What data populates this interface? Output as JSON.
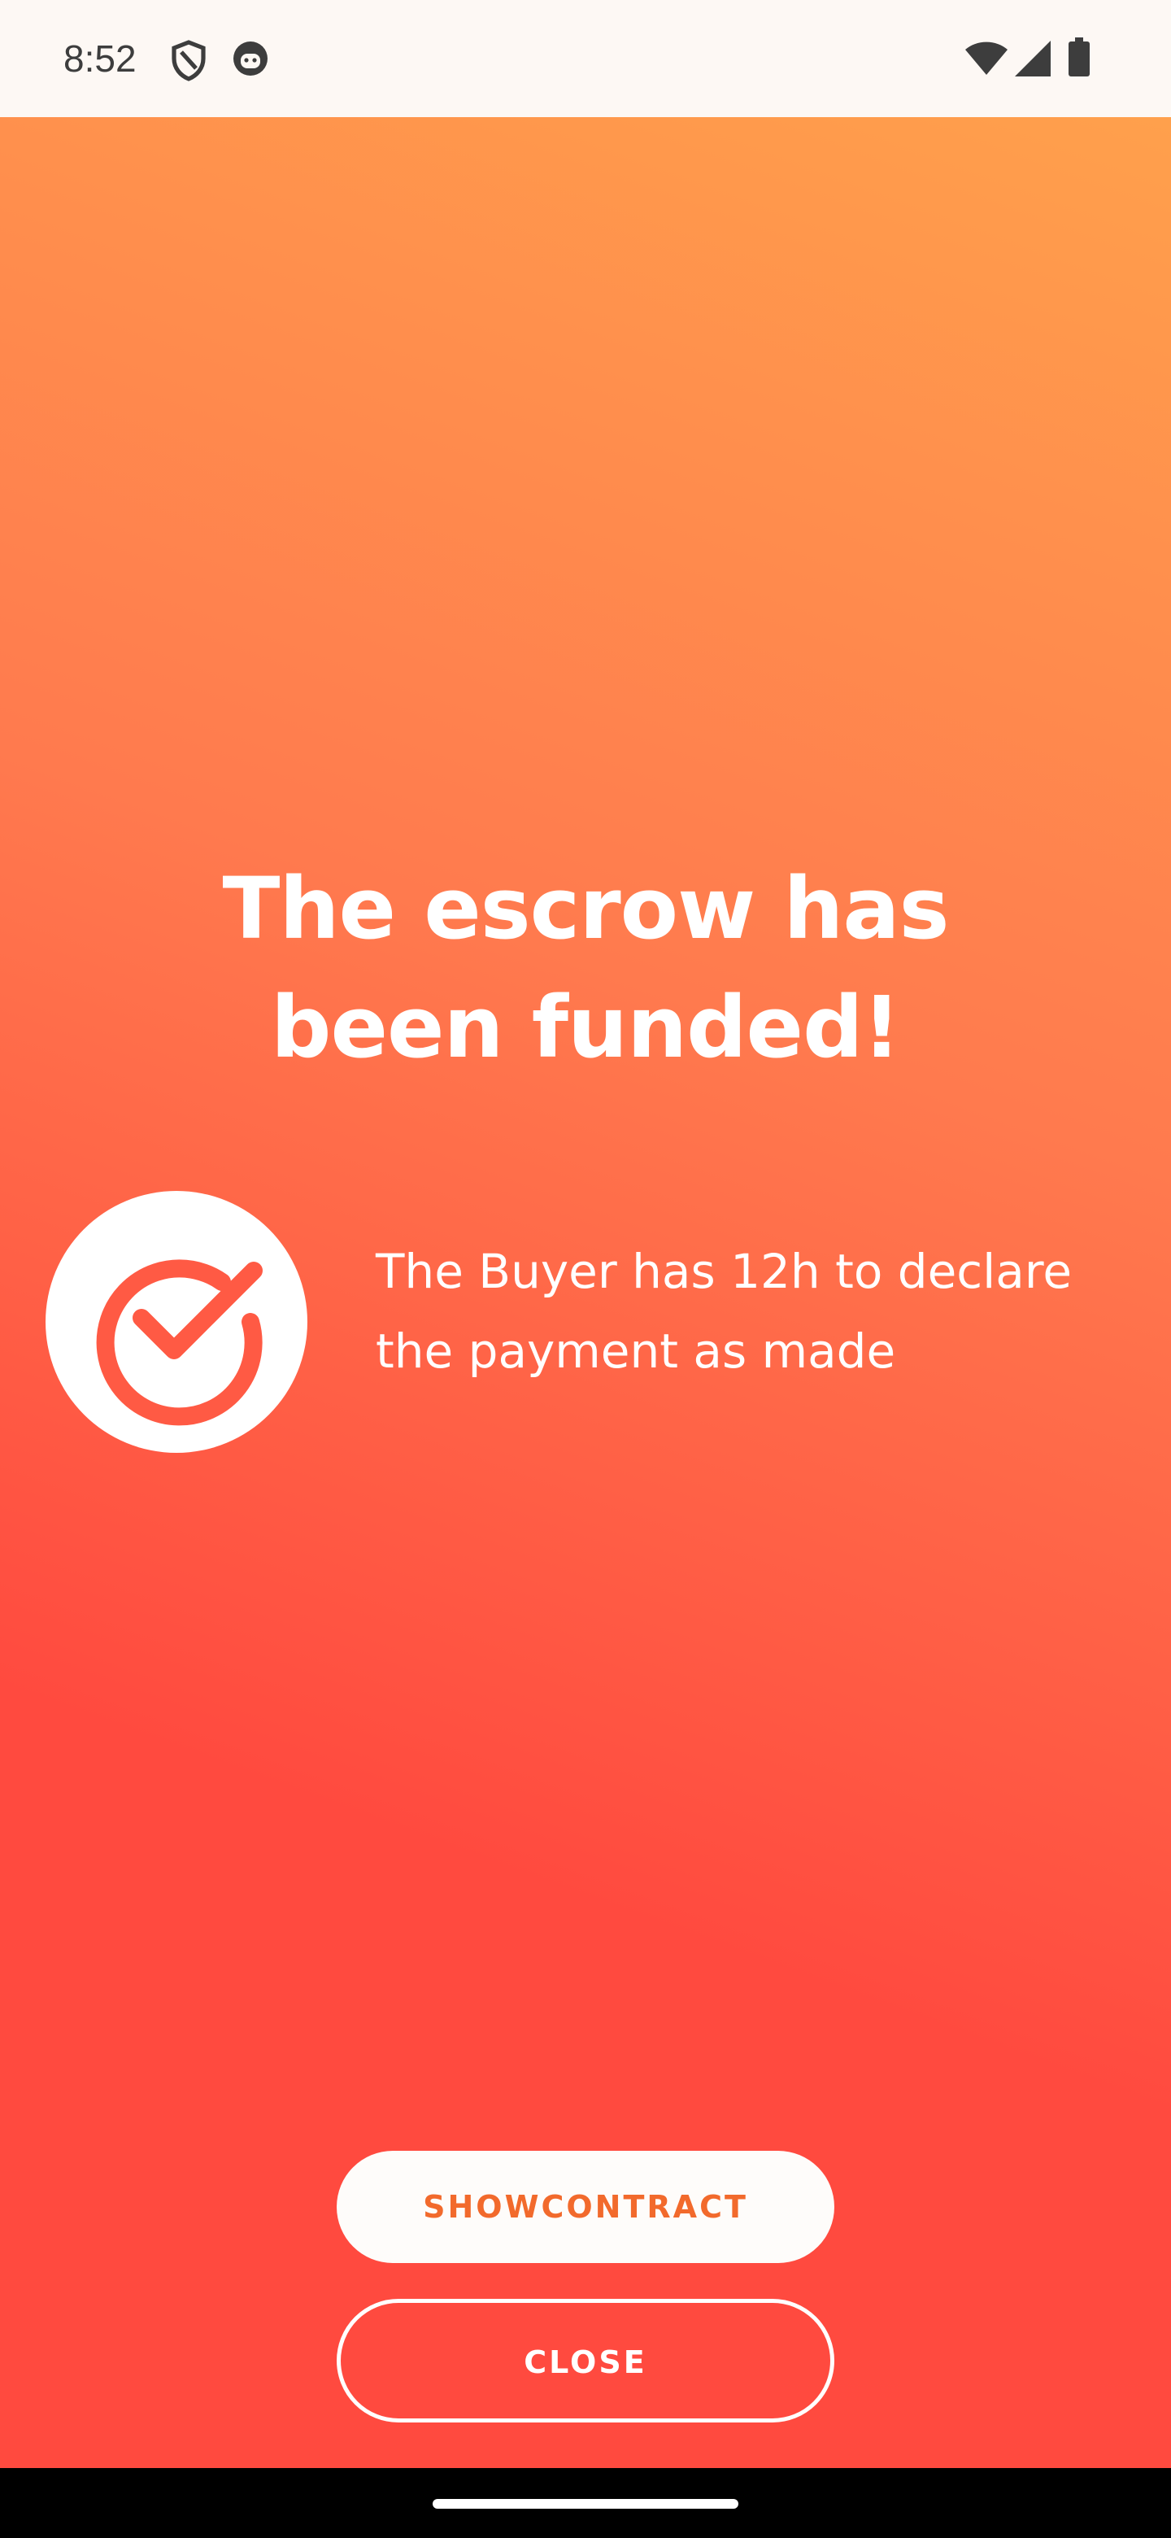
{
  "status_bar": {
    "time": "8:52",
    "icons": [
      "shield-icon",
      "android-face-icon",
      "wifi-icon",
      "signal-icon",
      "battery-icon"
    ]
  },
  "screen": {
    "title_line1": "The escrow has",
    "title_line2": "been funded!",
    "info_line1": "The Buyer has 12h to declare",
    "info_line2": "the payment as made",
    "badge_icon": "check-circle-icon"
  },
  "actions": {
    "show_contract_label": "SHOWCONTRACT",
    "close_label": "CLOSE"
  },
  "colors": {
    "gradient_red": "#ff4a3f",
    "gradient_orange": "#ffa04c",
    "button_text": "#f26a2c",
    "status_bar_bg": "#fdf8f4"
  }
}
